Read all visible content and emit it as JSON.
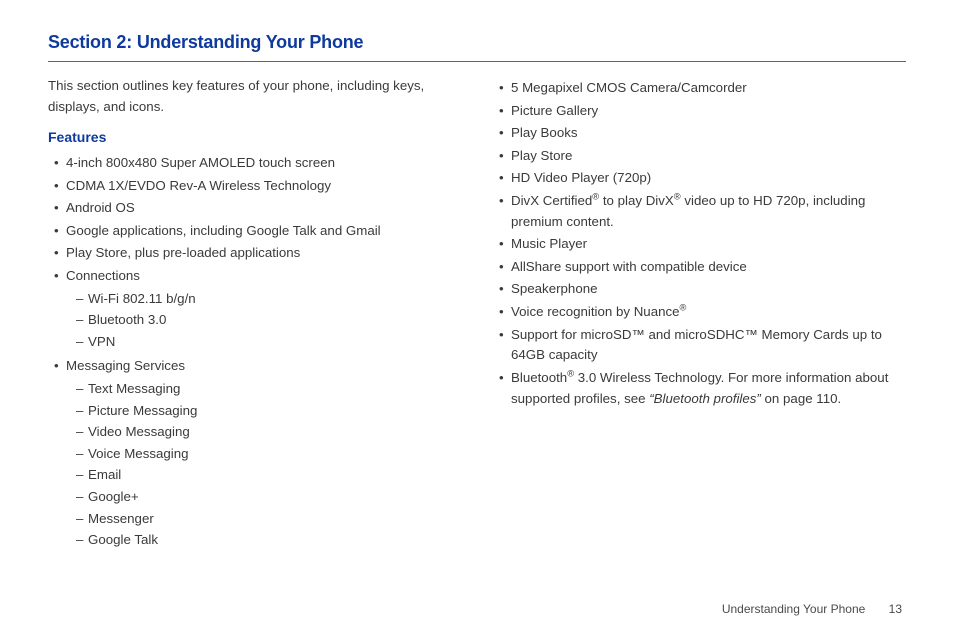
{
  "section_title": "Section 2: Understanding Your Phone",
  "intro": "This section outlines key features of your phone, including keys, displays, and icons.",
  "features_heading": "Features",
  "col1": {
    "items": [
      {
        "text": "4-inch 800x480 Super AMOLED touch screen"
      },
      {
        "text": "CDMA 1X/EVDO Rev-A Wireless Technology"
      },
      {
        "text": "Android OS"
      },
      {
        "text": "Google applications, including Google Talk and Gmail"
      },
      {
        "text": "Play Store, plus pre-loaded applications"
      },
      {
        "text": "Connections",
        "sub": [
          "Wi-Fi 802.11 b/g/n",
          "Bluetooth 3.0",
          "VPN"
        ]
      },
      {
        "text": "Messaging Services",
        "sub": [
          "Text Messaging",
          "Picture Messaging",
          "Video Messaging",
          "Voice Messaging",
          "Email",
          "Google+",
          "Messenger",
          "Google Talk"
        ]
      }
    ]
  },
  "col2": {
    "items": [
      {
        "text": "5 Megapixel CMOS Camera/Camcorder"
      },
      {
        "text": "Picture Gallery"
      },
      {
        "text": "Play Books"
      },
      {
        "text": "Play Store"
      },
      {
        "text": "HD Video Player (720p)"
      },
      {
        "html": "DivX Certified<sup>®</sup> to play DivX<sup>®</sup> video up to HD 720p, including premium content."
      },
      {
        "text": "Music Player"
      },
      {
        "text": "AllShare support with compatible device"
      },
      {
        "text": "Speakerphone"
      },
      {
        "html": "Voice recognition by Nuance<sup>®</sup>"
      },
      {
        "text": "Support for microSD™ and microSDHC™ Memory Cards up to 64GB capacity"
      },
      {
        "html": "Bluetooth<sup>®</sup> 3.0 Wireless Technology. For more information about supported profiles, see <i>“Bluetooth profiles”</i> on page 110."
      }
    ]
  },
  "footer": {
    "label": "Understanding Your Phone",
    "page": "13"
  }
}
